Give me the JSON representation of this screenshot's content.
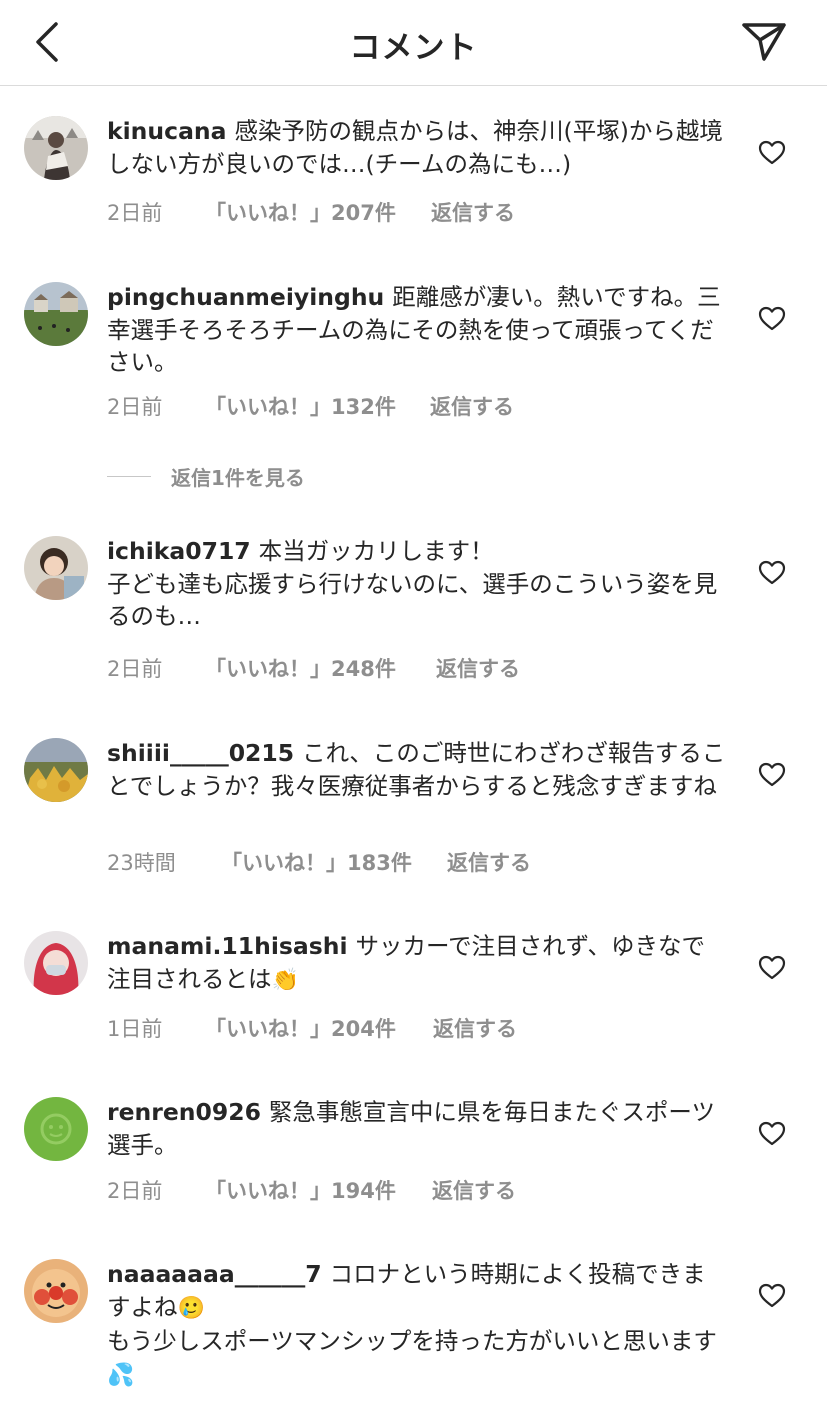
{
  "header": {
    "title": "コメント",
    "back_icon": "chevron-left-icon",
    "send_icon": "paper-plane-icon"
  },
  "comments": [
    {
      "username": "kinucana",
      "text": "感染予防の観点からは、神奈川(平塚)から越境しない方が良いのでは…(チームの為にも…)",
      "time": "2日前",
      "likes": "「いいね！」207件",
      "reply": "返信する"
    },
    {
      "username": "pingchuanmeiyinghu",
      "text": "距離感が凄い。熱いですね。三幸選手そろそろチームの為にその熱を使って頑張ってください。",
      "time": "2日前",
      "likes": "「いいね！」132件",
      "reply": "返信する"
    },
    {
      "username": "ichika0717",
      "text": "本当ガッカリします！",
      "text2": "子ども達も応援すら行けないのに、選手のこういう姿を見るのも…",
      "time": "2日前",
      "likes": "「いいね！」248件",
      "reply": "返信する"
    },
    {
      "username": "shiiii_____0215",
      "text": "これ、このご時世にわざわざ報告することでしょうか？我々医療従事者からすると残念すぎますね",
      "time": "23時間",
      "likes": "「いいね！」183件",
      "reply": "返信する"
    },
    {
      "username": "manami.11hisashi",
      "text": "サッカーで注目されず、ゆきなで注目されるとは",
      "emoji": "👏",
      "time": "1日前",
      "likes": "「いいね！」204件",
      "reply": "返信する"
    },
    {
      "username": "renren0926",
      "text": "緊急事態宣言中に県を毎日またぐスポーツ選手。",
      "time": "2日前",
      "likes": "「いいね！」194件",
      "reply": "返信する"
    },
    {
      "username": "naaaaaaa______7",
      "text": "コロナという時期によく投稿できますよね",
      "emoji": "🥲",
      "text2": "もう少しスポーツマンシップを持った方がいいと思います",
      "emoji2": "💦"
    }
  ],
  "view_replies": "返信1件を見る",
  "colors": {
    "text": "#262626",
    "secondary": "#8e8e8e",
    "divider": "#dbdbdb"
  }
}
